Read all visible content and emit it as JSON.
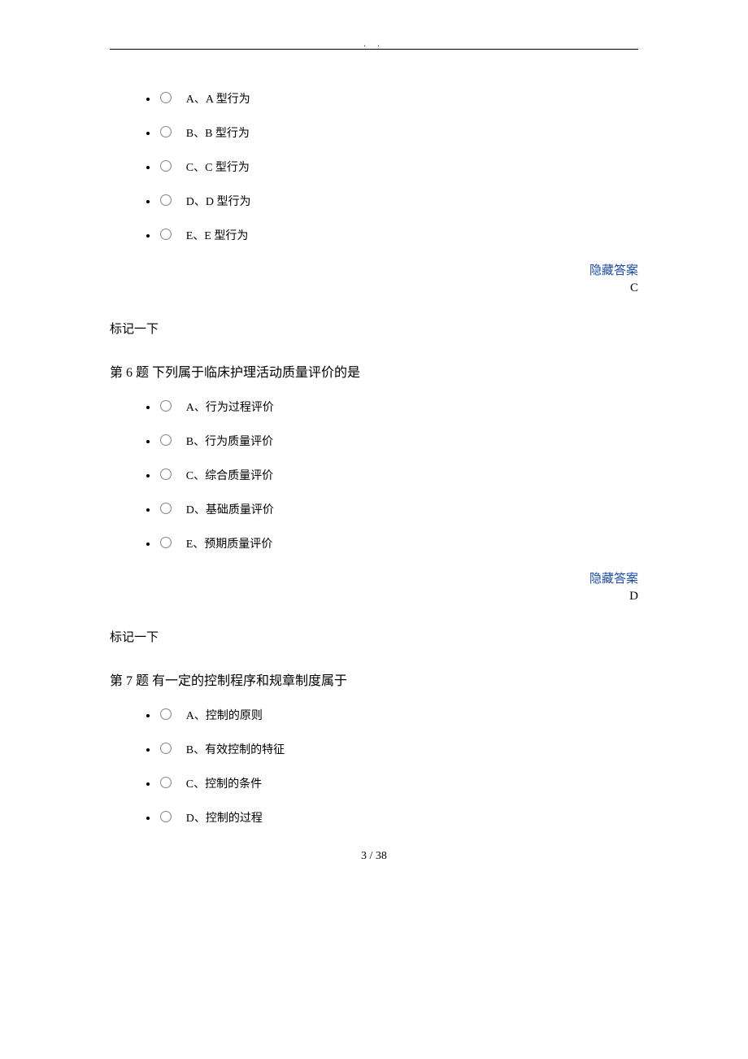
{
  "question5": {
    "options": [
      "A、A 型行为",
      "B、B 型行为",
      "C、C 型行为",
      "D、D 型行为",
      "E、E 型行为"
    ],
    "hideAnswer": "隐藏答案",
    "answer": "C"
  },
  "markLabel": "标记一下",
  "question6": {
    "title": "第 6 题  下列属于临床护理活动质量评价的是",
    "options": [
      "A、行为过程评价",
      "B、行为质量评价",
      "C、综合质量评价",
      "D、基础质量评价",
      "E、预期质量评价"
    ],
    "hideAnswer": "隐藏答案",
    "answer": "D"
  },
  "question7": {
    "title": "第 7 题  有一定的控制程序和规章制度属于",
    "options": [
      "A、控制的原则",
      "B、有效控制的特征",
      "C、控制的条件",
      "D、控制的过程"
    ]
  },
  "pageNumber": "3  / 38"
}
